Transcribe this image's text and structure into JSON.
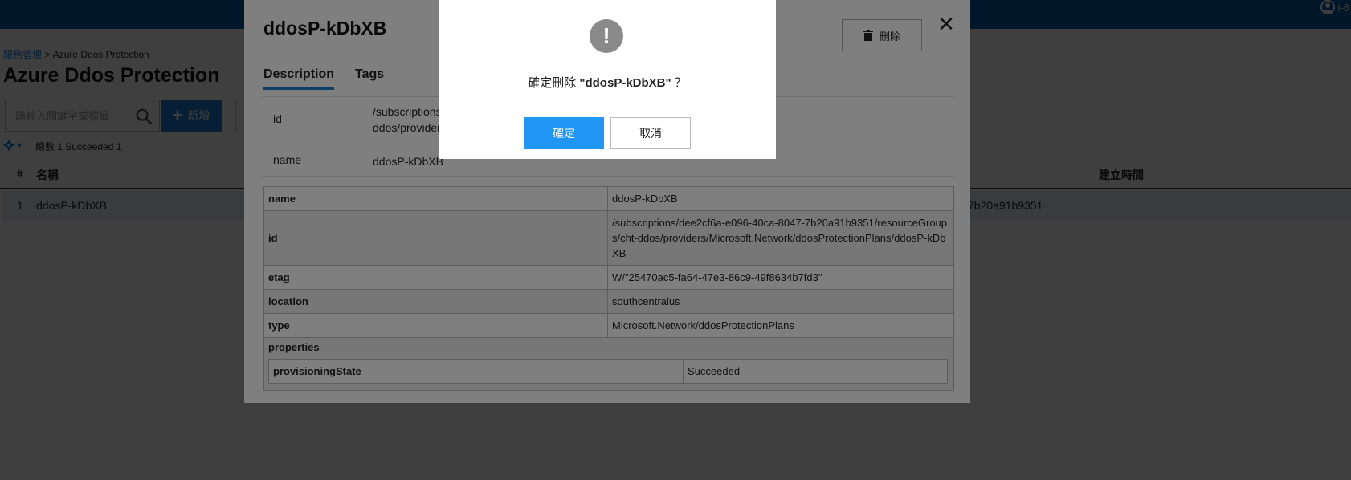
{
  "topbar": {
    "user_label": "i-6"
  },
  "breadcrumb": {
    "parent": "服務管理",
    "separator": ">",
    "current": "Azure Ddos Protection"
  },
  "page": {
    "title": "Azure Ddos Protection"
  },
  "search": {
    "placeholder": "請輸入關鍵字或標籤"
  },
  "toolbar": {
    "add_label": "新增"
  },
  "summary": {
    "text": "總數 1  Succeeded 1"
  },
  "table": {
    "headers": {
      "num": "#",
      "name": "名稱",
      "created": "建立時間"
    },
    "rows": [
      {
        "num": "1",
        "name": "ddosP-kDbXB",
        "subscription_fragment": "7b20a91b9351"
      }
    ]
  },
  "detail": {
    "title": "ddosP-kDbXB",
    "delete_label": "刪除",
    "close_symbol": "✕",
    "tabs": [
      {
        "label": "Description",
        "active": true
      },
      {
        "label": "Tags",
        "active": false
      }
    ],
    "summary_rows": [
      {
        "key": "id",
        "value": "/subscriptions/dee2cf6a-e096-40ca-8047-7b20a91b9351/resourceGroups/cht-ddos/providers/Microsoft.Network/ddosProtectionPlans/ddosP-kDbXB"
      },
      {
        "key": "name",
        "value": "ddosP-kDbXB"
      }
    ],
    "properties_table": [
      {
        "key": "name",
        "value": "ddosP-kDbXB"
      },
      {
        "key": "id",
        "value": "/subscriptions/dee2cf6a-e096-40ca-8047-7b20a91b9351/resourceGroups/cht-ddos/providers/Microsoft.Network/ddosProtectionPlans/ddosP-kDbXB"
      },
      {
        "key": "etag",
        "value": "W/\"25470ac5-fa64-47e3-86c9-49f8634b7fd3\""
      },
      {
        "key": "location",
        "value": "southcentralus"
      },
      {
        "key": "type",
        "value": "Microsoft.Network/ddosProtectionPlans"
      }
    ],
    "properties": {
      "label": "properties",
      "nested": [
        {
          "key": "provisioningState",
          "value": "Succeeded"
        }
      ]
    }
  },
  "confirm": {
    "icon": "!",
    "message_prefix": "確定刪除",
    "target": "\"ddosP-kDbXB\"",
    "message_suffix": "？",
    "ok_label": "確定",
    "cancel_label": "取消"
  },
  "colors": {
    "topbar": "#0b5aa6",
    "primary": "#2196f3",
    "link": "#1a7fd4"
  }
}
